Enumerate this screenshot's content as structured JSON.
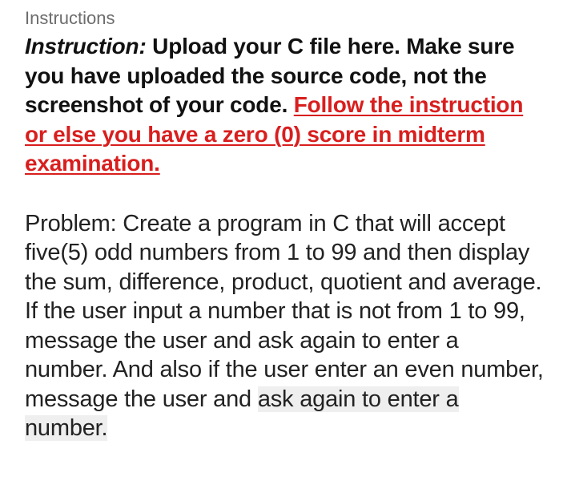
{
  "section": {
    "label": "Instructions"
  },
  "instruction": {
    "lead": "Instruction:",
    "text": " Upload your C file here. Make sure you have uploaded the source code, not the screenshot of your code. ",
    "warning": "Follow the instruction or else you have a zero (0) score in midterm examination. "
  },
  "problem": {
    "text": "Problem: Create a program in C that will accept five(5) odd numbers from 1 to 99 and then display the sum, difference, product, quotient and average. If the user input a number that is not from 1 to 99, message the user and ask again to enter a number. And also if the user enter an even number, message the user and ",
    "highlighted": "ask again to enter a number."
  },
  "colors": {
    "warning": "#d91e1e",
    "label": "#6d6d6d",
    "highlight_bg": "#efefef"
  }
}
